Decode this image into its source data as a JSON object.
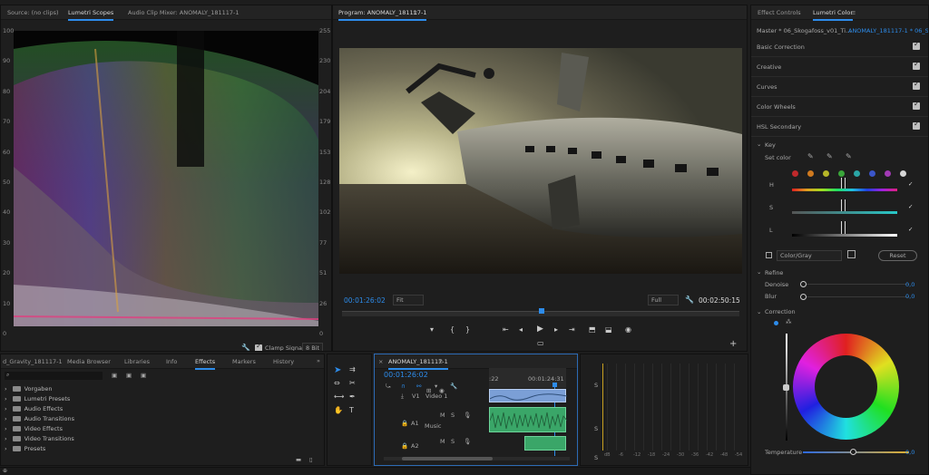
{
  "scopes_panel": {
    "tabs": [
      "Source: (no clips)",
      "Lumetri Scopes",
      "Audio Clip Mixer: ANOMALY_181117-1"
    ],
    "left_scale": [
      "100",
      "90",
      "80",
      "70",
      "60",
      "50",
      "40",
      "30",
      "20",
      "10",
      "0"
    ],
    "right_scale": [
      "255",
      "230",
      "204",
      "179",
      "153",
      "128",
      "102",
      "77",
      "51",
      "26",
      "0"
    ],
    "clamp_signal_label": "Clamp Signal",
    "bit_depth": "8 Bit"
  },
  "program_monitor": {
    "title": "Program: ANOMALY_181117-1",
    "timecode_current": "00:01:26:02",
    "fit_select": "Fit",
    "quality_select": "Full",
    "timecode_duration": "00:02:50:15"
  },
  "effect_panel": {
    "tabs": [
      "Effect Controls",
      "Lumetri Color"
    ],
    "master_clip": "Master * 06_Skogafoss_v01_Ti...",
    "sequence_clip": "ANOMALY_181117-1 * 06_Sko...",
    "sections": [
      "Basic Correction",
      "Creative",
      "Curves",
      "Color Wheels",
      "HSL Secondary"
    ],
    "key_label": "Key",
    "set_color_label": "Set color",
    "swatch_colors": [
      "#c0292b",
      "#d07a1f",
      "#b6b628",
      "#3aa63a",
      "#2aa5a5",
      "#3a55c9",
      "#a23ab5",
      "#d6d6d6"
    ],
    "h_label": "H",
    "s_label": "S",
    "l_label": "L",
    "color_gray_label": "Color/Gray",
    "reset_label": "Reset",
    "refine_label": "Refine",
    "denoise_label": "Denoise",
    "denoise_value": "0,0",
    "blur_label": "Blur",
    "blur_value": "0,0",
    "correction_label": "Correction",
    "temperature_label": "Temperature",
    "temperature_value": "0,0"
  },
  "project_panel": {
    "tabs": [
      "d_Gravity_181117-1",
      "Media Browser",
      "Libraries",
      "Info",
      "Effects",
      "Markers",
      "History"
    ],
    "items": [
      "Vorgaben",
      "Lumetri Presets",
      "Audio Effects",
      "Audio Transitions",
      "Video Effects",
      "Video Transitions",
      "Presets"
    ]
  },
  "timeline": {
    "tab": "ANOMALY_181117-1",
    "timecode": "00:01:26:02",
    "ruler_left": ":22",
    "ruler_right": "00:01:24:31",
    "tracks": {
      "v1_label": "V1",
      "video1_name": "Video 1",
      "a1_label": "A1",
      "music_name": "Music",
      "a2_label": "A2"
    }
  },
  "audio_meters": {
    "solo_labels": [
      "S",
      "S",
      "S"
    ],
    "db_scale": [
      "dB",
      "-6",
      "-12",
      "-18",
      "-24",
      "-30",
      "-36",
      "-42",
      "-48",
      "-54"
    ]
  }
}
